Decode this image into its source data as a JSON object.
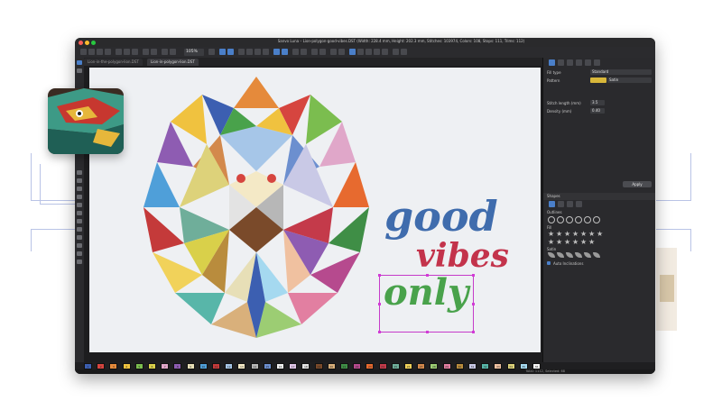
{
  "window": {
    "title": "Sanvo Luna – Lion-polygon-good-vibes.DST (Width: 228.4 mm, Height: 202.3 mm, Stitches: 103974, Colors: 108, Stops: 111, Trims: 112)",
    "colors": {
      "bg": "#1d1d1f",
      "canvas": "#eef0f3",
      "accent": "#4a7fc9",
      "selection": "#c53bc9"
    }
  },
  "toolbar": {
    "zoom": "105%"
  },
  "tabs": [
    {
      "label": "Lion-in-the-polygon-lion.DST"
    },
    {
      "label": "Lion-in-polygon-lion.DST"
    }
  ],
  "canvas": {
    "lines": [
      {
        "text": "good",
        "color": "#3f6cad"
      },
      {
        "text": "vibes",
        "color": "#c3334b"
      },
      {
        "text": "only",
        "color": "#49a24b"
      }
    ]
  },
  "properties": {
    "fill_type_label": "Fill type",
    "fill_type_value": "Standard",
    "pattern_label": "Pattern",
    "pattern_value": "Satin",
    "pattern_color": "#d8b73a",
    "stitch_length_label": "Stitch length (mm)",
    "stitch_length_value": "3.5",
    "density_label": "Density (mm)",
    "density_value": "0.40",
    "apply_label": "Apply"
  },
  "shapes_panel": {
    "title": "Shapes",
    "outlines_label": "Outlines",
    "fill_label": "Fill",
    "satin_label": "Satin",
    "auto_inclinations_label": "Auto Inclinations"
  },
  "palette": [
    {
      "n": "1",
      "c": "#3c5fb1"
    },
    {
      "n": "2",
      "c": "#d6453f"
    },
    {
      "n": "3",
      "c": "#e58a3b"
    },
    {
      "n": "4",
      "c": "#f0c23f"
    },
    {
      "n": "5",
      "c": "#7bbd4f"
    },
    {
      "n": "6",
      "c": "#d9d04a"
    },
    {
      "n": "7",
      "c": "#e0a7c9"
    },
    {
      "n": "8",
      "c": "#8e5cb2"
    },
    {
      "n": "9",
      "c": "#e7dfb7"
    },
    {
      "n": "10",
      "c": "#4f9fd9"
    },
    {
      "n": "11",
      "c": "#c43a3a"
    },
    {
      "n": "12",
      "c": "#a6c6e8"
    },
    {
      "n": "13",
      "c": "#f4e9c6"
    },
    {
      "n": "14",
      "c": "#b7b7b7"
    },
    {
      "n": "15",
      "c": "#6c8fcf"
    },
    {
      "n": "16",
      "c": "#f2f2f2"
    },
    {
      "n": "17",
      "c": "#e0c6e8"
    },
    {
      "n": "18",
      "c": "#e3e3e3"
    },
    {
      "n": "19",
      "c": "#7a4a2a"
    },
    {
      "n": "20",
      "c": "#d9b07b"
    },
    {
      "n": "21",
      "c": "#3f8e46"
    },
    {
      "n": "22",
      "c": "#b64a8e"
    },
    {
      "n": "23",
      "c": "#e76a2f"
    },
    {
      "n": "24",
      "c": "#c43a4a"
    },
    {
      "n": "25",
      "c": "#6fae9a"
    },
    {
      "n": "26",
      "c": "#f1d25a"
    },
    {
      "n": "27",
      "c": "#d3894c"
    },
    {
      "n": "28",
      "c": "#9ccd73"
    },
    {
      "n": "29",
      "c": "#e27fa1"
    },
    {
      "n": "30",
      "c": "#b98c3d"
    },
    {
      "n": "31",
      "c": "#c9c9e6"
    },
    {
      "n": "32",
      "c": "#58b6a9"
    },
    {
      "n": "33",
      "c": "#f0c1a0"
    },
    {
      "n": "34",
      "c": "#ddd27a"
    },
    {
      "n": "35",
      "c": "#a5d9f0"
    },
    {
      "n": "36",
      "c": "#f6f6f6"
    }
  ],
  "status": {
    "text": "Total: 1112, Selected: 68"
  }
}
